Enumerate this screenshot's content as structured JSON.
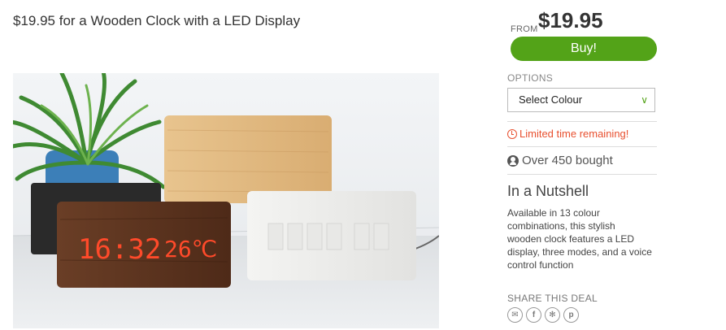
{
  "deal": {
    "title": "$19.95 for a Wooden Clock with a LED Display"
  },
  "image": {
    "led_time": "16:32",
    "led_temp": "26℃"
  },
  "sidebar": {
    "from_label": "FROM",
    "price": "$19.95",
    "buy_label": "Buy!",
    "options_label": "OPTIONS",
    "select_value": "Select Colour",
    "limited_text": "Limited time remaining!",
    "bought_text": "Over 450 bought",
    "nutshell_title": "In a Nutshell",
    "nutshell_text": "Available in 13 colour combinations, this stylish wooden clock features a LED display, three modes, and a voice control function",
    "share_label": "SHARE THIS DEAL",
    "share_icons": [
      "mail-icon",
      "facebook-icon",
      "twitter-icon",
      "pinterest-icon"
    ]
  },
  "colors": {
    "buy_green": "#53a318",
    "limited_red": "#e8502f",
    "led_red": "#ff4a2a"
  }
}
